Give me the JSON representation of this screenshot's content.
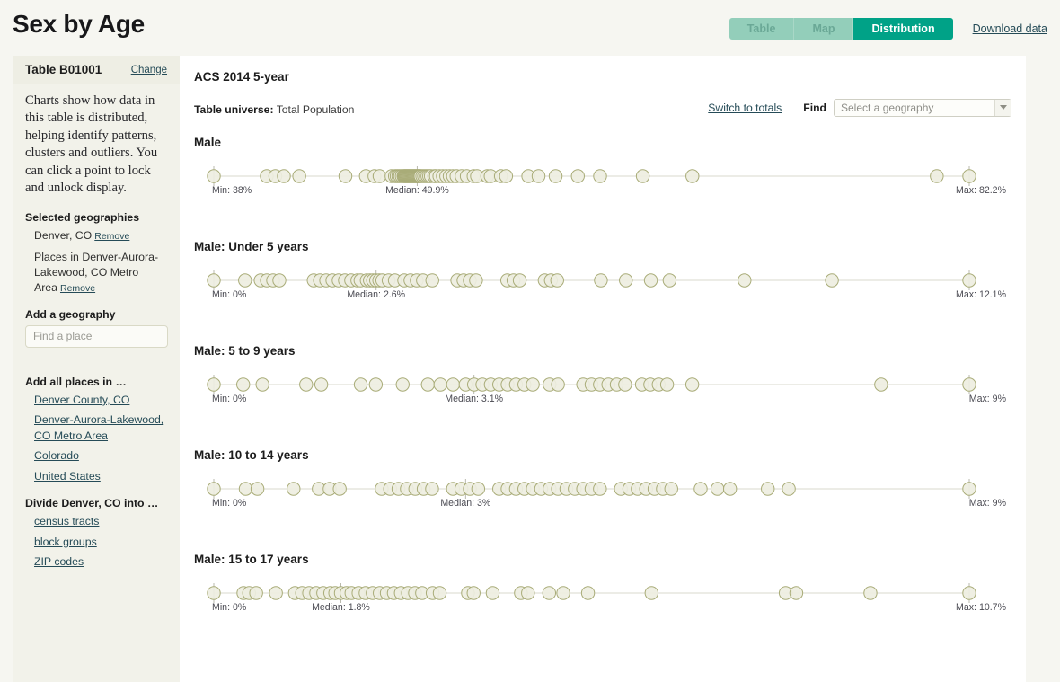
{
  "header": {
    "title": "Sex by Age",
    "tabs": [
      {
        "label": "Table",
        "active": false
      },
      {
        "label": "Map",
        "active": false
      },
      {
        "label": "Distribution",
        "active": true
      }
    ],
    "download_label": "Download data",
    "accent_active": "#00a287",
    "accent_inactive": "#93ceba",
    "link_color": "#254b57"
  },
  "sidebar": {
    "table_name": "Table B01001",
    "change_label": "Change",
    "intro": "Charts show how data in this table is distributed, helping identify patterns, clusters and outliers. You can click a point to lock and unlock display.",
    "selected_title": "Selected geographies",
    "selected": [
      {
        "name": "Denver, CO",
        "remove_label": "Remove"
      },
      {
        "name": "Places in Denver-Aurora-Lakewood, CO Metro Area",
        "remove_label": "Remove"
      }
    ],
    "add_geo_title": "Add a geography",
    "find_place_placeholder": "Find a place",
    "find_place_value": "",
    "add_all_title": "Add all places in …",
    "add_all_links": [
      "Denver County, CO",
      "Denver-Aurora-Lakewood, CO Metro Area",
      "Colorado",
      "United States"
    ],
    "divide_title": "Divide Denver, CO into …",
    "divide_links": [
      "census tracts",
      "block groups",
      "ZIP codes"
    ]
  },
  "main": {
    "release_title": "ACS 2014 5-year",
    "universe_label": "Table universe:",
    "universe_value": "Total Population",
    "switch_to_totals": "Switch to totals",
    "find_label": "Find",
    "geo_select_placeholder": "Select a geography",
    "geo_select_value": ""
  },
  "chart_data": [
    {
      "type": "scatter",
      "title": "Male",
      "xlabel": "",
      "ylabel": "",
      "min_label": "Min: 38%",
      "median_label": "Median: 49.9%",
      "max_label": "Max: 82.2%",
      "min": 38.0,
      "median": 49.9,
      "max": 82.2,
      "xlim": [
        38.0,
        82.2
      ],
      "grid": false,
      "dot_color": "#eeeee1",
      "dot_stroke": "#a9ac78",
      "values": [
        38.0,
        41.1,
        41.6,
        42.1,
        43.0,
        45.7,
        46.9,
        47.4,
        47.7,
        48.4,
        48.6,
        48.7,
        48.8,
        48.9,
        49.0,
        49.1,
        49.15,
        49.2,
        49.25,
        49.3,
        49.35,
        49.4,
        49.45,
        49.5,
        49.55,
        49.6,
        49.65,
        49.7,
        49.75,
        49.8,
        49.85,
        49.9,
        49.95,
        50.0,
        50.05,
        50.1,
        50.2,
        50.3,
        50.4,
        50.5,
        50.6,
        50.7,
        50.9,
        51.0,
        51.2,
        51.4,
        51.6,
        51.8,
        52.0,
        52.2,
        52.5,
        52.8,
        53.2,
        53.4,
        54.0,
        54.2,
        54.8,
        55.1,
        56.4,
        57.0,
        58.0,
        59.3,
        60.6,
        63.1,
        66.0,
        80.3,
        82.2
      ]
    },
    {
      "type": "scatter",
      "title": "Male: Under 5 years",
      "xlabel": "",
      "ylabel": "",
      "min_label": "Min: 0%",
      "median_label": "Median: 2.6%",
      "max_label": "Max: 12.1%",
      "min": 0.0,
      "median": 2.6,
      "max": 12.1,
      "xlim": [
        0.0,
        12.1
      ],
      "grid": false,
      "dot_color": "#eeeee1",
      "dot_stroke": "#a9ac78",
      "values": [
        0.0,
        0.5,
        0.75,
        0.85,
        0.95,
        1.05,
        1.6,
        1.7,
        1.8,
        1.9,
        2.0,
        2.1,
        2.2,
        2.3,
        2.35,
        2.45,
        2.5,
        2.55,
        2.6,
        2.65,
        2.7,
        2.8,
        2.9,
        3.05,
        3.15,
        3.25,
        3.35,
        3.5,
        3.9,
        4.0,
        4.1,
        4.2,
        4.7,
        4.8,
        4.9,
        5.3,
        5.4,
        5.5,
        6.2,
        6.6,
        7.0,
        7.3,
        8.5,
        9.9,
        12.1
      ]
    },
    {
      "type": "scatter",
      "title": "Male: 5 to 9 years",
      "xlabel": "",
      "ylabel": "",
      "min_label": "Min: 0%",
      "median_label": "Median: 3.1%",
      "max_label": "Max: 9%",
      "min": 0.0,
      "median": 3.1,
      "max": 9.0,
      "xlim": [
        0.0,
        9.0
      ],
      "grid": false,
      "dot_color": "#eeeee1",
      "dot_stroke": "#a9ac78",
      "values": [
        0.0,
        0.35,
        0.58,
        1.1,
        1.28,
        1.75,
        1.93,
        2.25,
        2.55,
        2.7,
        2.85,
        3.0,
        3.1,
        3.2,
        3.3,
        3.4,
        3.5,
        3.6,
        3.7,
        3.8,
        4.0,
        4.1,
        4.4,
        4.5,
        4.6,
        4.7,
        4.8,
        4.9,
        5.1,
        5.2,
        5.3,
        5.4,
        5.7,
        7.95,
        9.0
      ]
    },
    {
      "type": "scatter",
      "title": "Male: 10 to 14 years",
      "xlabel": "",
      "ylabel": "",
      "min_label": "Min: 0%",
      "median_label": "Median: 3%",
      "max_label": "Max: 9%",
      "min": 0.0,
      "median": 3.0,
      "max": 9.0,
      "xlim": [
        0.0,
        9.0
      ],
      "grid": false,
      "dot_color": "#eeeee1",
      "dot_stroke": "#a9ac78",
      "values": [
        0.0,
        0.38,
        0.52,
        0.95,
        1.25,
        1.38,
        1.5,
        2.0,
        2.1,
        2.2,
        2.3,
        2.4,
        2.5,
        2.6,
        2.85,
        2.95,
        3.05,
        3.15,
        3.4,
        3.5,
        3.6,
        3.7,
        3.8,
        3.9,
        4.0,
        4.1,
        4.2,
        4.3,
        4.4,
        4.5,
        4.6,
        4.85,
        4.95,
        5.05,
        5.15,
        5.25,
        5.35,
        5.45,
        5.8,
        6.0,
        6.15,
        6.6,
        6.85,
        9.0
      ]
    },
    {
      "type": "scatter",
      "title": "Male: 15 to 17 years",
      "xlabel": "",
      "ylabel": "",
      "min_label": "Min: 0%",
      "median_label": "Median: 1.8%",
      "max_label": "Max: 10.7%",
      "min": 0.0,
      "median": 1.8,
      "max": 10.7,
      "xlim": [
        0.0,
        10.7
      ],
      "grid": false,
      "dot_color": "#eeeee1",
      "dot_stroke": "#a9ac78",
      "values": [
        0.0,
        0.42,
        0.5,
        0.6,
        0.88,
        1.15,
        1.25,
        1.35,
        1.45,
        1.55,
        1.65,
        1.72,
        1.8,
        1.88,
        1.95,
        2.05,
        2.15,
        2.25,
        2.35,
        2.45,
        2.55,
        2.65,
        2.75,
        2.85,
        2.95,
        3.1,
        3.2,
        3.6,
        3.68,
        3.95,
        4.35,
        4.45,
        4.75,
        4.95,
        5.3,
        6.2,
        8.1,
        8.25,
        9.3,
        10.7
      ]
    }
  ]
}
